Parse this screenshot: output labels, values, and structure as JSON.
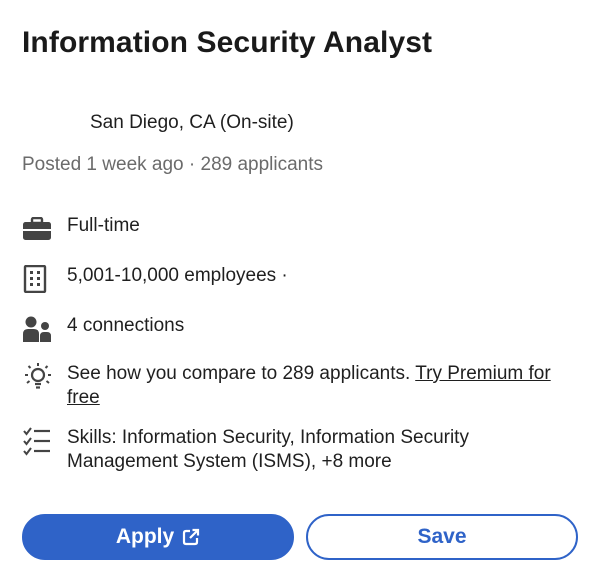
{
  "job": {
    "title": "Information Security Analyst",
    "location": "San Diego, CA (On-site)",
    "posted": "Posted 1 week ago · 289 applicants"
  },
  "details": {
    "employment_type": "Full-time",
    "company_size": "5,001-10,000 employees ·",
    "connections": "4 connections",
    "premium_text": "See how you compare to 289 applicants. ",
    "premium_link": "Try Premium for free",
    "skills": "Skills: Information Security, Information Security Management System (ISMS), +8 more"
  },
  "icons": {
    "employment": "briefcase-icon",
    "company": "building-icon",
    "connections": "people-icon",
    "premium": "lightbulb-icon",
    "skills": "checklist-icon",
    "apply": "external-link-icon"
  },
  "actions": {
    "apply_label": "Apply",
    "save_label": "Save"
  },
  "colors": {
    "accent": "#2f63c8",
    "text": "#1f1f1f",
    "muted": "#6b6b6b"
  }
}
